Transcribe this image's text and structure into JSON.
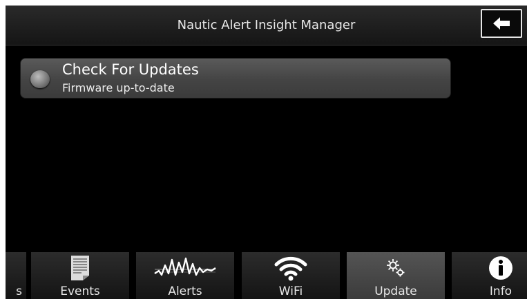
{
  "header": {
    "title": "Nautic Alert Insight Manager",
    "back_icon": "arrow-left-icon"
  },
  "list": {
    "items": [
      {
        "title": "Check For Updates",
        "subtitle": "Firmware up-to-date",
        "status_icon": "status-indicator-icon"
      }
    ]
  },
  "tabs": [
    {
      "label": "s",
      "icon": "partial-tab",
      "active": false
    },
    {
      "label": "Events",
      "icon": "document-icon",
      "active": false
    },
    {
      "label": "Alerts",
      "icon": "waveform-icon",
      "active": false
    },
    {
      "label": "WiFi",
      "icon": "wifi-icon",
      "active": false
    },
    {
      "label": "Update",
      "icon": "gears-icon",
      "active": true
    },
    {
      "label": "Info",
      "icon": "info-icon",
      "active": false
    }
  ],
  "colors": {
    "background": "#000000",
    "active_tab": "#4a4a4a",
    "text": "#e8e8e8"
  }
}
